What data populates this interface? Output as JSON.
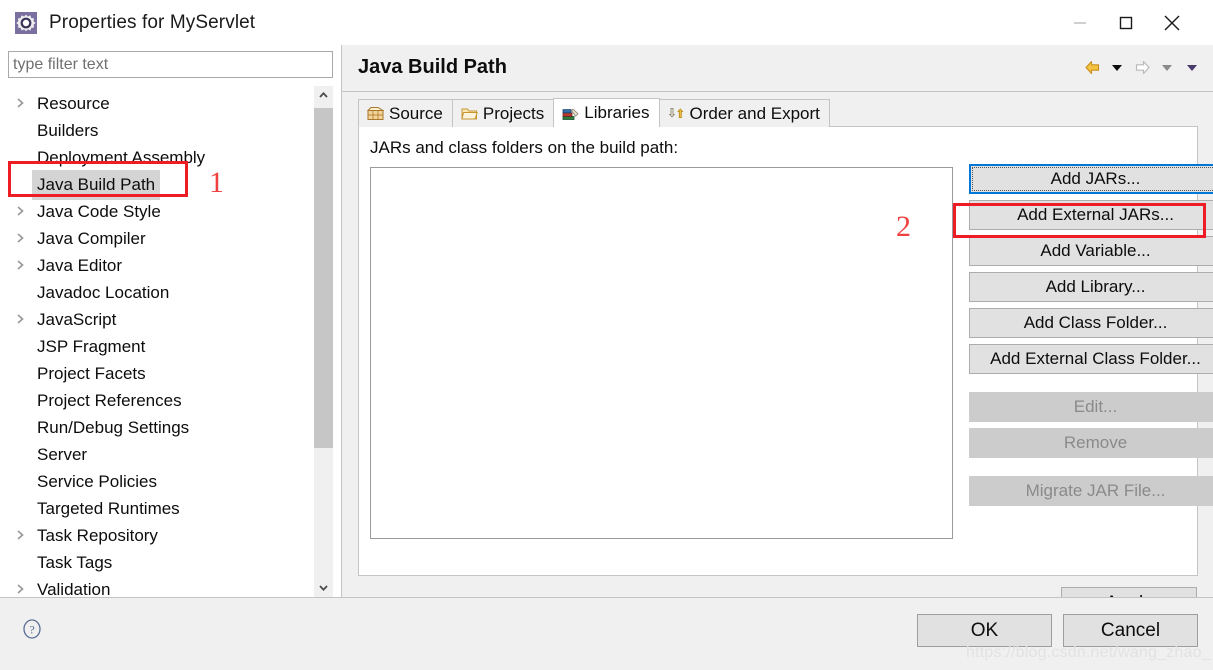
{
  "window": {
    "title": "Properties for MyServlet",
    "icon": "properties-gear-icon",
    "controls": {
      "minimize": "minimize-icon",
      "maximize": "maximize-icon",
      "close": "close-icon"
    }
  },
  "sidebar": {
    "filter": {
      "placeholder": "type filter text",
      "value": ""
    },
    "items": [
      {
        "label": "Resource",
        "expandable": true,
        "selected": false
      },
      {
        "label": "Builders",
        "expandable": false,
        "selected": false
      },
      {
        "label": "Deployment Assembly",
        "expandable": false,
        "selected": false
      },
      {
        "label": "Java Build Path",
        "expandable": false,
        "selected": true
      },
      {
        "label": "Java Code Style",
        "expandable": true,
        "selected": false
      },
      {
        "label": "Java Compiler",
        "expandable": true,
        "selected": false
      },
      {
        "label": "Java Editor",
        "expandable": true,
        "selected": false
      },
      {
        "label": "Javadoc Location",
        "expandable": false,
        "selected": false
      },
      {
        "label": "JavaScript",
        "expandable": true,
        "selected": false
      },
      {
        "label": "JSP Fragment",
        "expandable": false,
        "selected": false
      },
      {
        "label": "Project Facets",
        "expandable": false,
        "selected": false
      },
      {
        "label": "Project References",
        "expandable": false,
        "selected": false
      },
      {
        "label": "Run/Debug Settings",
        "expandable": false,
        "selected": false
      },
      {
        "label": "Server",
        "expandable": false,
        "selected": false
      },
      {
        "label": "Service Policies",
        "expandable": false,
        "selected": false
      },
      {
        "label": "Targeted Runtimes",
        "expandable": false,
        "selected": false
      },
      {
        "label": "Task Repository",
        "expandable": true,
        "selected": false
      },
      {
        "label": "Task Tags",
        "expandable": false,
        "selected": false
      },
      {
        "label": "Validation",
        "expandable": true,
        "selected": false
      }
    ],
    "scrollbar": {
      "up_icon": "chevron-up-icon",
      "down_icon": "chevron-down-icon"
    }
  },
  "content": {
    "page_title": "Java Build Path",
    "nav": [
      {
        "name": "back-arrow-icon"
      },
      {
        "name": "back-dropdown-icon"
      },
      {
        "name": "forward-arrow-icon"
      },
      {
        "name": "forward-dropdown-icon"
      },
      {
        "name": "menu-dropdown-icon"
      }
    ],
    "tabs": [
      {
        "label": "Source",
        "icon": "package-icon",
        "active": false
      },
      {
        "label": "Projects",
        "icon": "folder-icon",
        "active": false
      },
      {
        "label": "Libraries",
        "icon": "books-icon",
        "active": true
      },
      {
        "label": "Order and Export",
        "icon": "order-arrows-icon",
        "active": false
      }
    ],
    "list_label": "JARs and class folders on the build path:",
    "list_items": [],
    "buttons": [
      {
        "label": "Add JARs...",
        "state": "focused"
      },
      {
        "label": "Add External JARs...",
        "state": "enabled"
      },
      {
        "label": "Add Variable...",
        "state": "enabled"
      },
      {
        "label": "Add Library...",
        "state": "enabled"
      },
      {
        "label": "Add Class Folder...",
        "state": "enabled"
      },
      {
        "label": "Add External Class Folder...",
        "state": "enabled"
      },
      {
        "label": "Edit...",
        "state": "disabled"
      },
      {
        "label": "Remove",
        "state": "disabled"
      },
      {
        "label": "Migrate JAR File...",
        "state": "disabled"
      }
    ],
    "apply_label": "Apply"
  },
  "footer": {
    "help_icon": "help-question-icon",
    "ok_label": "OK",
    "cancel_label": "Cancel",
    "watermark": "https://blog.csdn.net/wang_zhao_"
  },
  "annotations": [
    {
      "number": "1",
      "target": "Java Build Path"
    },
    {
      "number": "2",
      "target": "Add External JARs..."
    }
  ],
  "colors": {
    "accent_red": "#ee1c25",
    "annotation_number": "#ef4040",
    "focus_blue": "#0078d7",
    "dialog_bg": "#f0f0f0",
    "panel_white": "#ffffff",
    "selection_gray": "#d4d4d4",
    "button_face": "#e1e1e1",
    "disabled_face": "#cccccc"
  }
}
